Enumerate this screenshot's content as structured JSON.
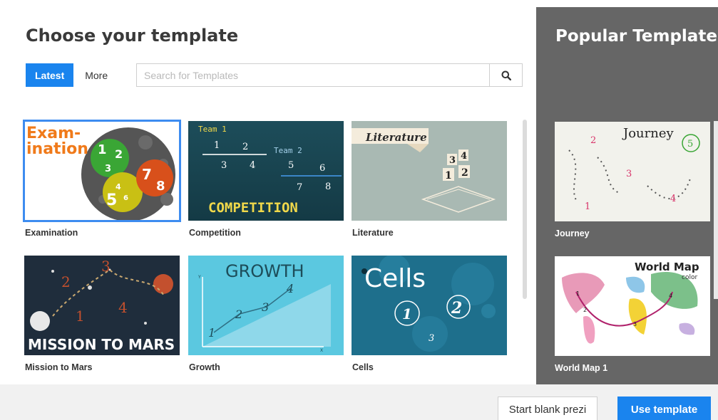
{
  "header": {
    "title": "Choose your template"
  },
  "tabs": [
    {
      "label": "Latest",
      "active": true
    },
    {
      "label": "More",
      "active": false
    }
  ],
  "search": {
    "placeholder": "Search for Templates",
    "value": ""
  },
  "templates": [
    {
      "label": "Examination",
      "selected": true,
      "thumb_text": [
        "Exam-",
        "ination",
        "1",
        "2",
        "3",
        "4",
        "5",
        "6",
        "7",
        "8"
      ]
    },
    {
      "label": "Competition",
      "selected": false,
      "thumb_text": [
        "Team 1",
        "Team 2",
        "1",
        "2",
        "3",
        "4",
        "5",
        "6",
        "7",
        "8",
        "COMPETITION"
      ]
    },
    {
      "label": "Literature",
      "selected": false,
      "thumb_text": [
        "Literature",
        "3",
        "4",
        "1",
        "2"
      ]
    },
    {
      "label": "Mission to Mars",
      "selected": false,
      "thumb_text": [
        "MISSION TO MARS",
        "1",
        "2",
        "3",
        "4"
      ]
    },
    {
      "label": "Growth",
      "selected": false,
      "thumb_text": [
        "GROWTH",
        "1",
        "2",
        "3",
        "4",
        "Y",
        "X"
      ]
    },
    {
      "label": "Cells",
      "selected": false,
      "thumb_text": [
        "Cells",
        "1",
        "2",
        "3"
      ]
    }
  ],
  "popular": {
    "title": "Popular Templates",
    "items": [
      {
        "label": "Journey",
        "thumb_text": [
          "Journey",
          "1",
          "2",
          "3",
          "4",
          "5"
        ]
      },
      {
        "label": "World Map 1",
        "thumb_text": [
          "World Map",
          "color",
          "1",
          "2",
          "3",
          "4"
        ]
      }
    ]
  },
  "footer": {
    "blank_label": "Start blank prezi",
    "use_label": "Use template"
  },
  "colors": {
    "accent": "#1a84ee",
    "panel": "#666666",
    "selection": "#3d8cf0"
  },
  "icons": {
    "search": "search-icon"
  }
}
